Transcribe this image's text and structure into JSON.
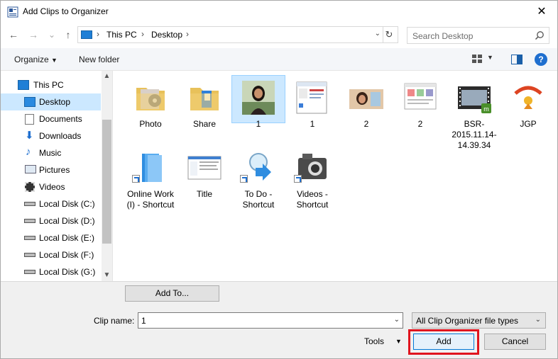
{
  "window": {
    "title": "Add Clips to Organizer"
  },
  "nav": {
    "back": "←",
    "forward": "→",
    "recent": "⌄",
    "up": "↑",
    "breadcrumb": [
      "This PC",
      "Desktop"
    ],
    "search_placeholder": "Search Desktop"
  },
  "toolbar": {
    "organize": "Organize",
    "new_folder": "New folder",
    "help": "?"
  },
  "sidebar": {
    "items": [
      {
        "label": "This PC",
        "icon": "computer-icon"
      },
      {
        "label": "Desktop",
        "icon": "desktop-icon",
        "selected": true
      },
      {
        "label": "Documents",
        "icon": "documents-icon"
      },
      {
        "label": "Downloads",
        "icon": "downloads-icon"
      },
      {
        "label": "Music",
        "icon": "music-icon"
      },
      {
        "label": "Pictures",
        "icon": "pictures-icon"
      },
      {
        "label": "Videos",
        "icon": "videos-icon"
      },
      {
        "label": "Local Disk (C:)",
        "icon": "drive-icon"
      },
      {
        "label": "Local Disk (D:)",
        "icon": "drive-icon"
      },
      {
        "label": "Local Disk (E:)",
        "icon": "drive-icon"
      },
      {
        "label": "Local Disk (F:)",
        "icon": "drive-icon"
      },
      {
        "label": "Local Disk (G:)",
        "icon": "drive-icon"
      }
    ]
  },
  "files": [
    {
      "label": "Photo",
      "icon": "folder-icon"
    },
    {
      "label": "Share",
      "icon": "folder-icon"
    },
    {
      "label": "1",
      "icon": "photo-thumbnail-icon",
      "selected": true
    },
    {
      "label": "1",
      "icon": "screenshot-thumbnail-icon"
    },
    {
      "label": "2",
      "icon": "photo-thumbnail-icon"
    },
    {
      "label": "2",
      "icon": "screenshot-thumbnail-icon"
    },
    {
      "label": "BSR-2015.11.14-14.39.34",
      "icon": "video-file-icon"
    },
    {
      "label": "JGP",
      "icon": "image-file-icon"
    },
    {
      "label": "Online Work (I) - Shortcut",
      "icon": "shortcut-drive-icon"
    },
    {
      "label": "Title",
      "icon": "screenshot-thumbnail-icon"
    },
    {
      "label": "To Do - Shortcut",
      "icon": "shortcut-search-icon"
    },
    {
      "label": "Videos - Shortcut",
      "icon": "shortcut-camera-icon"
    }
  ],
  "bottom": {
    "add_to": "Add To...",
    "clip_name_label": "Clip name:",
    "clip_name_value": "1",
    "file_type": "All Clip Organizer file types",
    "tools": "Tools",
    "add": "Add",
    "cancel": "Cancel"
  },
  "colors": {
    "selection": "#cce8ff",
    "highlight": "#e0141e",
    "accent": "#0078d7"
  }
}
